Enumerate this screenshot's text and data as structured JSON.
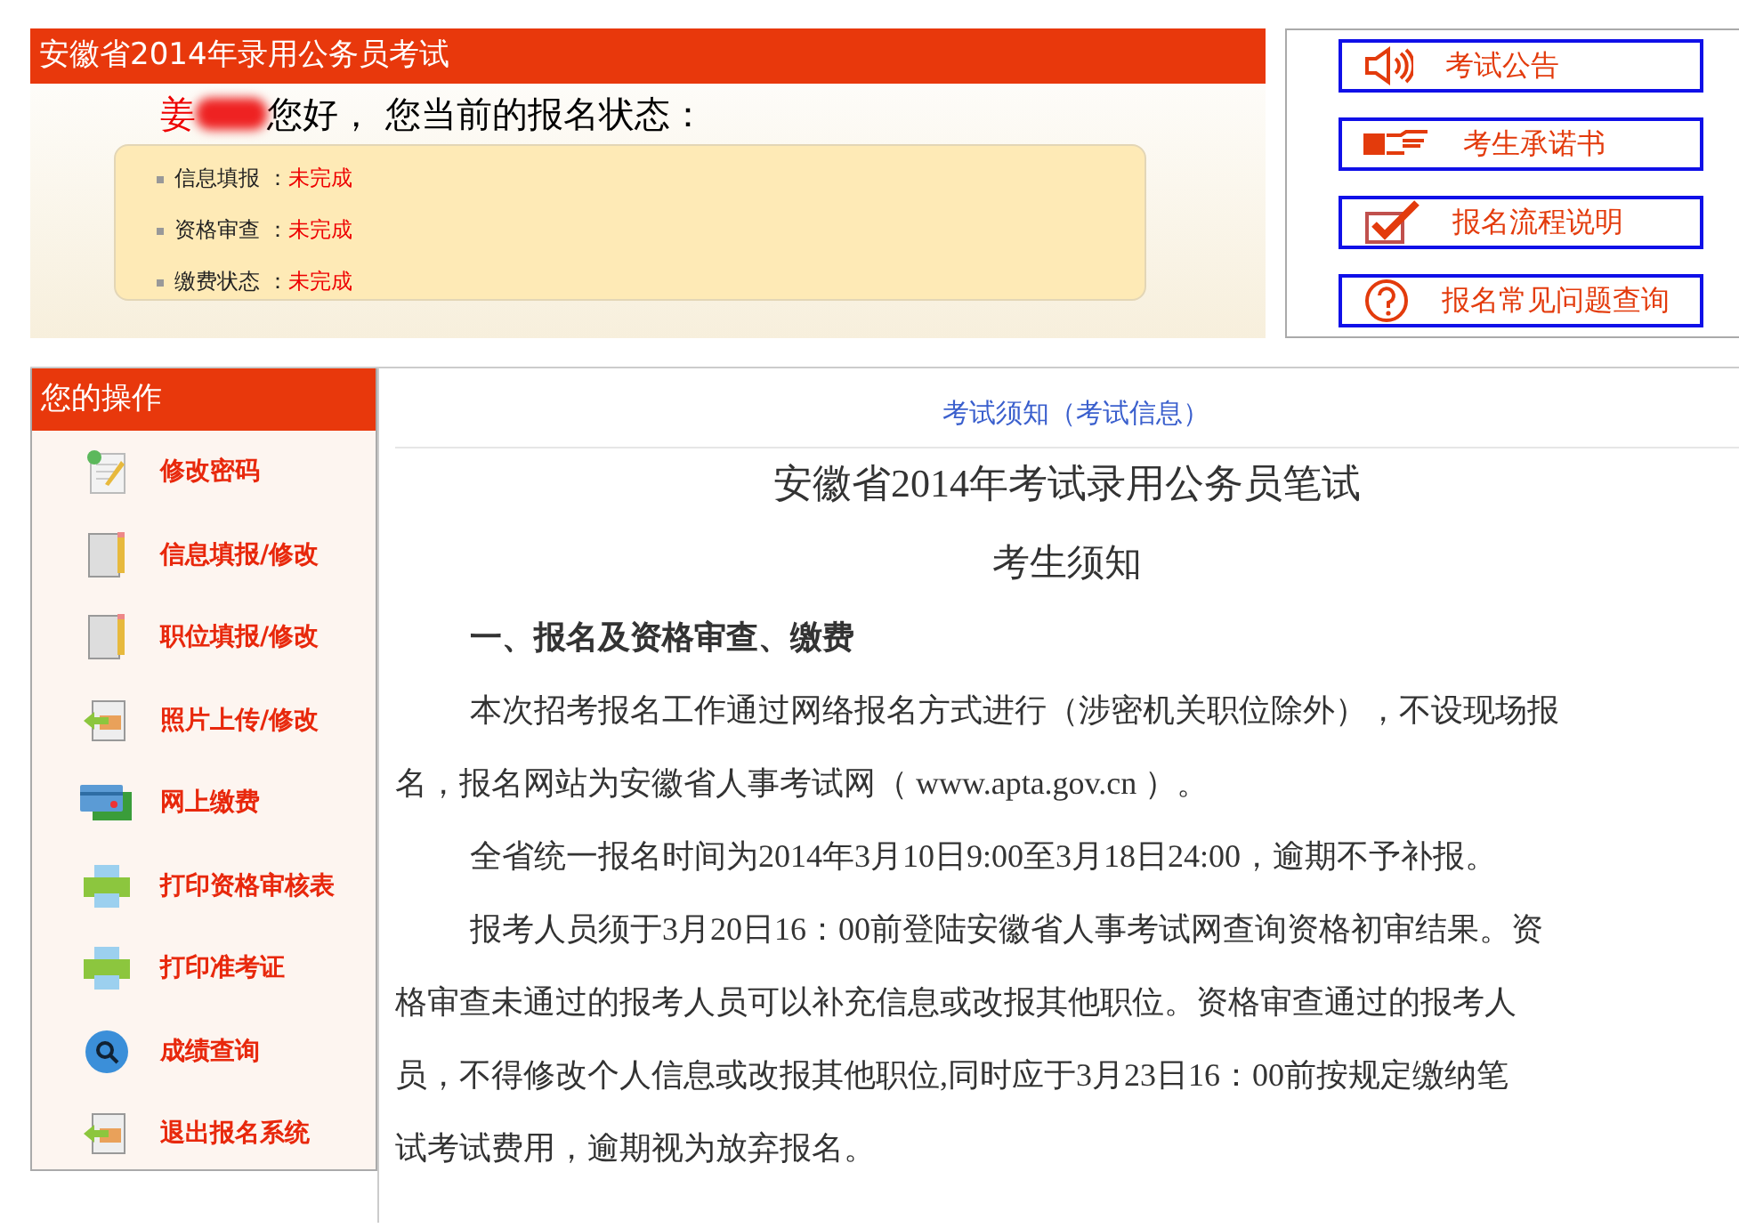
{
  "header": {
    "title": "安徽省2014年录用公务员考试",
    "greeting_name": "姜",
    "greeting": "您好， 您当前的报名状态：",
    "statuses": [
      {
        "label": "信息填报 ：",
        "value": "未完成"
      },
      {
        "label": "资格审查 ：",
        "value": "未完成"
      },
      {
        "label": "缴费状态 ：",
        "value": "未完成"
      }
    ]
  },
  "quick_links": [
    {
      "kind": "speaker",
      "label": "考试公告"
    },
    {
      "kind": "hand",
      "label": "考生承诺书"
    },
    {
      "kind": "check",
      "label": "报名流程说明"
    },
    {
      "kind": "question",
      "label": "报名常见问题查询"
    }
  ],
  "sidebar": {
    "title": "您的操作",
    "items": [
      {
        "kind": "note",
        "label": "修改密码"
      },
      {
        "kind": "book",
        "label": "信息填报/修改"
      },
      {
        "kind": "book",
        "label": "职位填报/修改"
      },
      {
        "kind": "upload",
        "label": "照片上传/修改"
      },
      {
        "kind": "card",
        "label": "网上缴费"
      },
      {
        "kind": "printer",
        "label": "打印资格审核表"
      },
      {
        "kind": "printer",
        "label": "打印准考证"
      },
      {
        "kind": "search",
        "label": "成绩查询"
      },
      {
        "kind": "upload",
        "label": "退出报名系统"
      }
    ]
  },
  "article": {
    "breadcrumb": "考试须知（考试信息）",
    "title": "安徽省2014年考试录用公务员笔试",
    "subtitle": "考生须知",
    "section": "一、报名及资格审查、缴费",
    "paragraphs": [
      [
        "本次招考报名工作通过网络报名方式进行（涉密机关职位除外），不设现场报",
        "名，报名网站为安徽省人事考试网（ www.apta.gov.cn ）。"
      ],
      [
        "全省统一报名时间为2014年3月10日9:00至3月18日24:00，逾期不予补报。"
      ],
      [
        "报考人员须于3月20日16：00前登陆安徽省人事考试网查询资格初审结果。资",
        "格审查未通过的报考人员可以补充信息或改报其他职位。资格审查通过的报考人",
        "员，不得修改个人信息或改报其他职位,同时应于3月23日16：00前按规定缴纳笔",
        "试考试费用，逾期视为放弃报名。"
      ]
    ]
  }
}
